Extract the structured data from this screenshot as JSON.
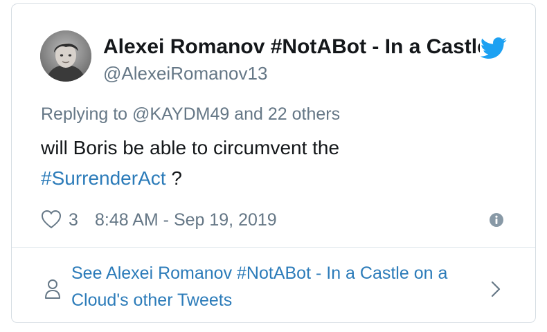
{
  "author": {
    "display_name": "Alexei Romanov #NotABot - In a Castle on a Cloud",
    "handle": "@AlexeiRomanov13",
    "avatar_icon": "avatar-photo"
  },
  "brand": {
    "icon": "twitter-bird-icon",
    "color": "#1da1f2"
  },
  "reply": {
    "prefix": "Replying to ",
    "mention": "@KAYDM49",
    "suffix": " and 22 others"
  },
  "tweet": {
    "text_before": "will Boris be able to circumvent the ",
    "hashtag": "#SurrenderAct",
    "text_after": " ?"
  },
  "meta": {
    "like_count": "3",
    "timestamp": "8:48 AM - Sep 19, 2019"
  },
  "footer": {
    "label": "See Alexei Romanov #NotABot - In a Castle on a Cloud's other Tweets"
  },
  "colors": {
    "text": "#14171a",
    "secondary": "#657786",
    "link": "#2b7bb9",
    "border": "#d6dde3"
  }
}
